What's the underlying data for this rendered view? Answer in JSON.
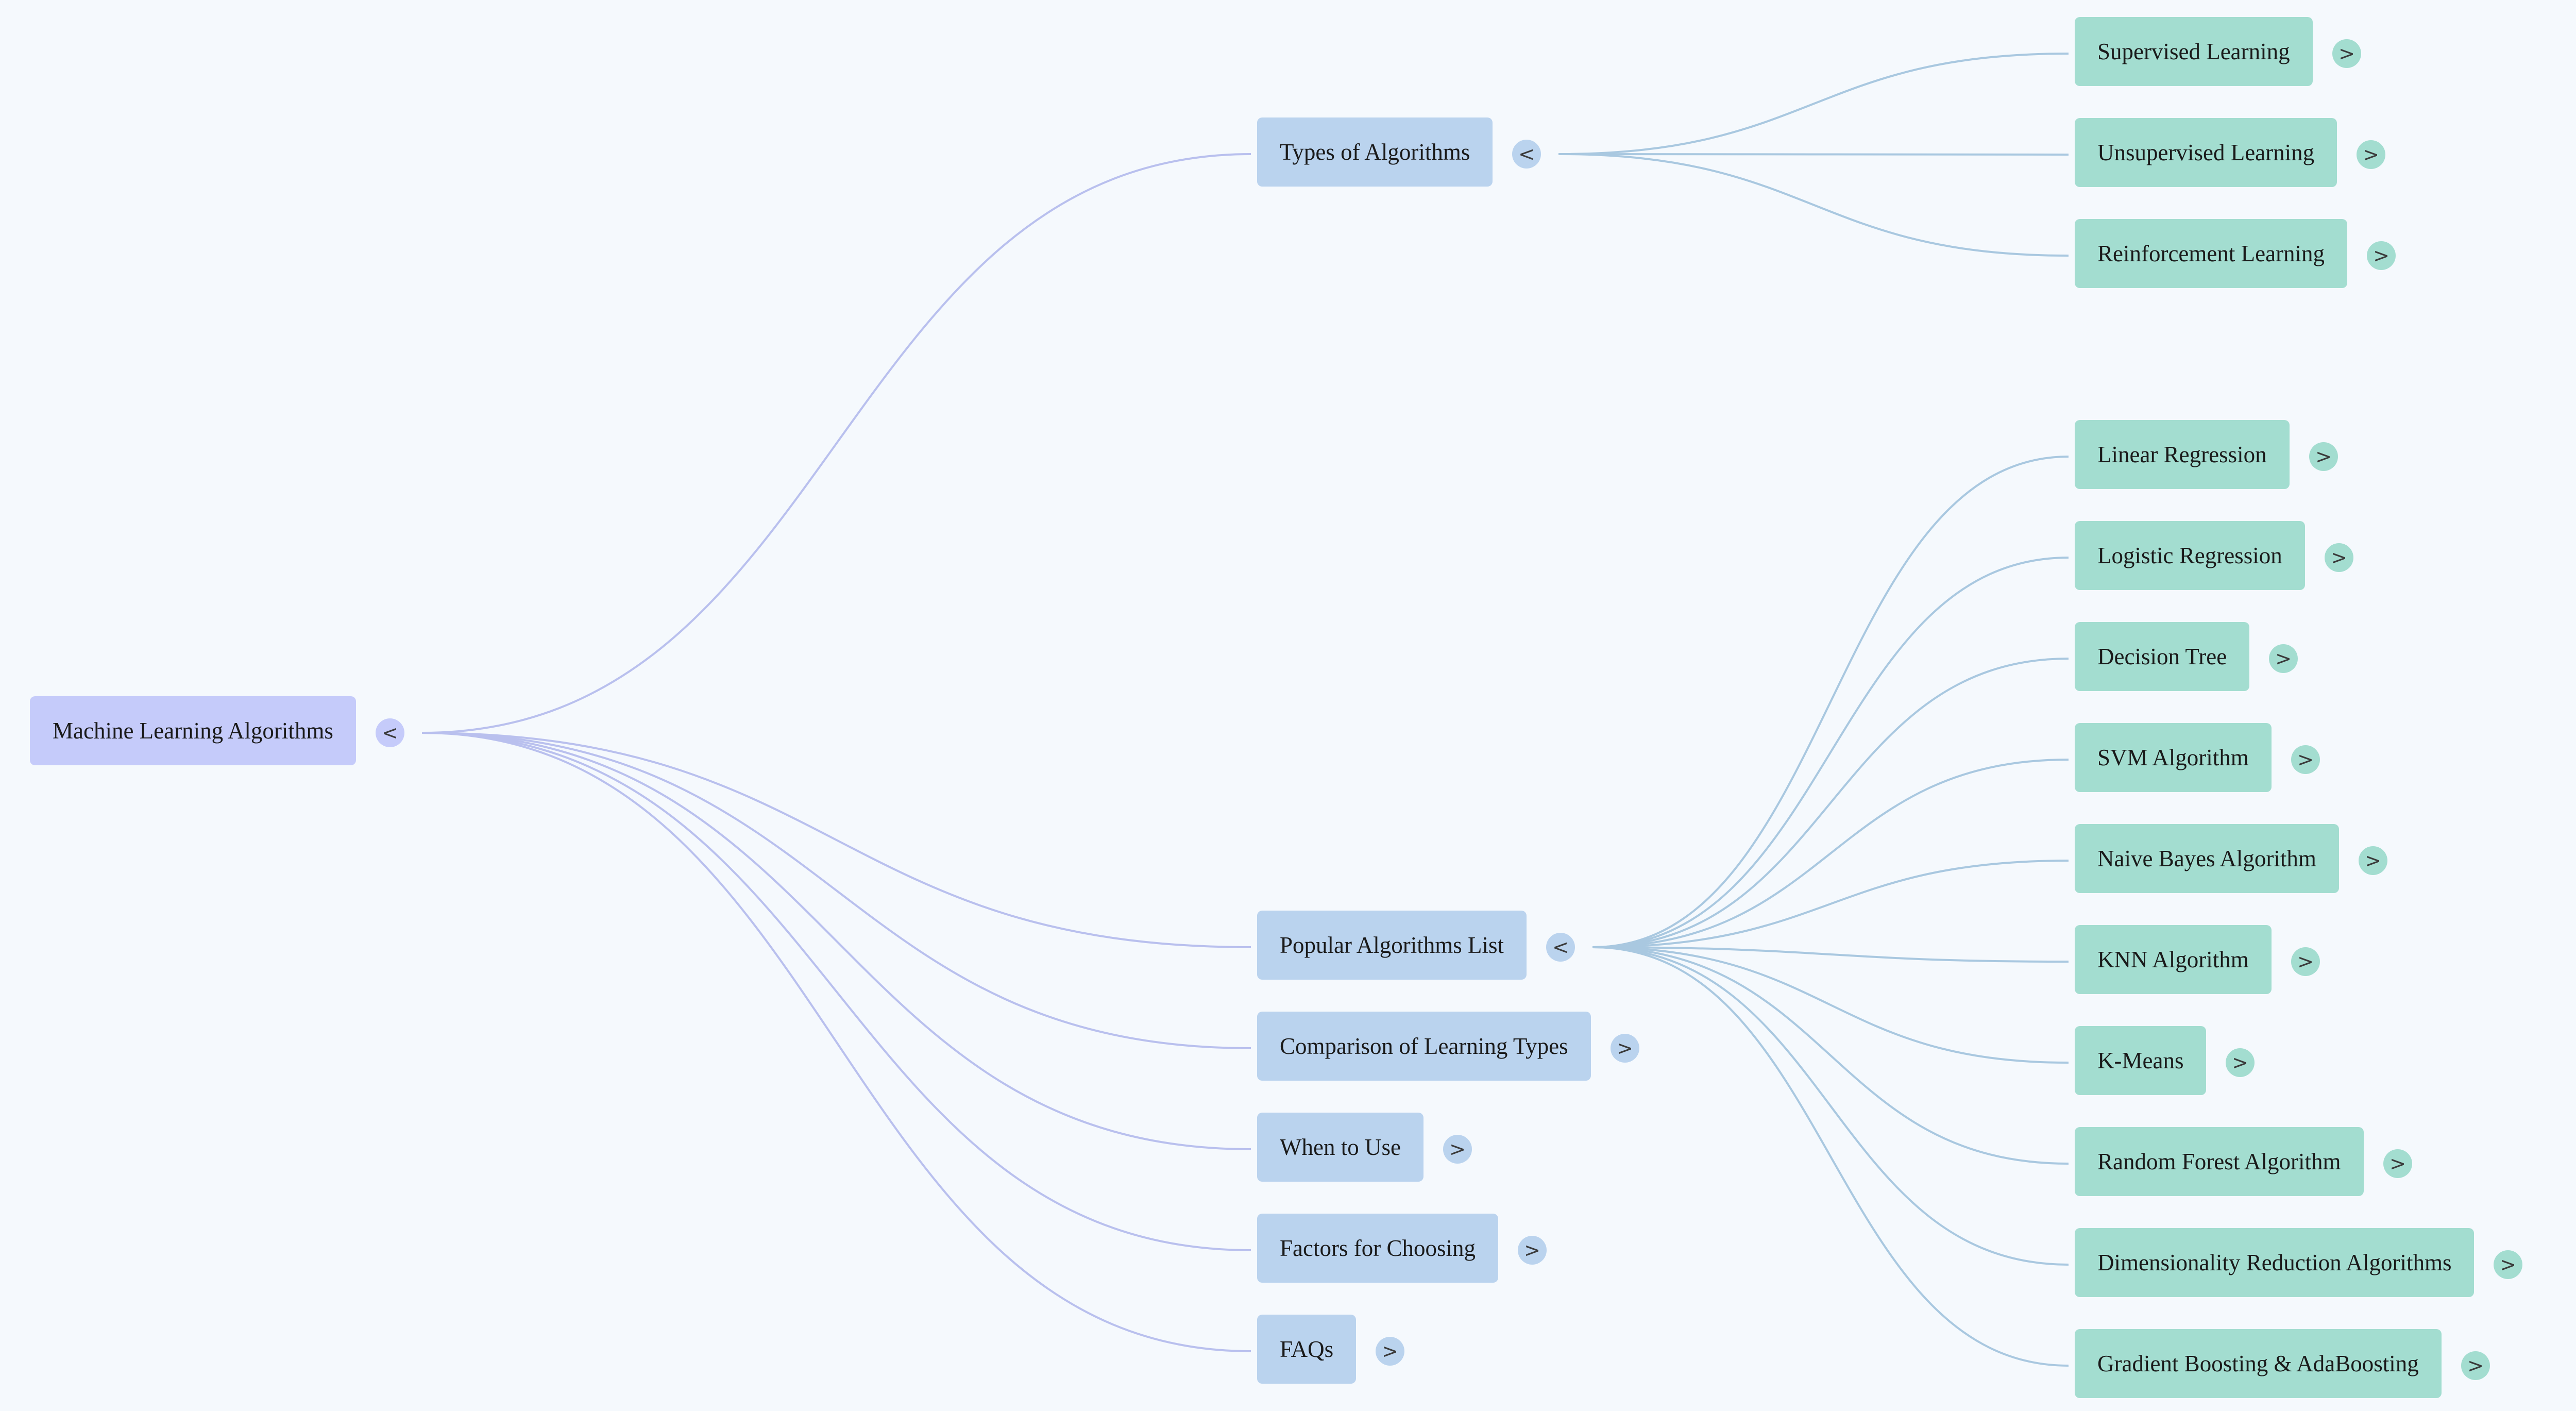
{
  "colors": {
    "background": "#f5f9fd",
    "root_fill": "#c5cbfa",
    "level1_fill": "#bad3ee",
    "level2_fill": "#a3ddd0",
    "root_edge": "#b9c0ee",
    "level1_edge": "#a9c8e0"
  },
  "root": {
    "label": "Machine Learning Algorithms",
    "toggle": "<",
    "children": [
      {
        "label": "Types of Algorithms",
        "toggle": "<",
        "children": [
          {
            "label": "Supervised Learning",
            "toggle": ">"
          },
          {
            "label": "Unsupervised Learning",
            "toggle": ">"
          },
          {
            "label": "Reinforcement Learning",
            "toggle": ">"
          }
        ]
      },
      {
        "label": "Popular Algorithms List",
        "toggle": "<",
        "children": [
          {
            "label": "Linear Regression",
            "toggle": ">"
          },
          {
            "label": "Logistic Regression",
            "toggle": ">"
          },
          {
            "label": "Decision Tree",
            "toggle": ">"
          },
          {
            "label": "SVM Algorithm",
            "toggle": ">"
          },
          {
            "label": "Naive Bayes Algorithm",
            "toggle": ">"
          },
          {
            "label": "KNN Algorithm",
            "toggle": ">"
          },
          {
            "label": "K-Means",
            "toggle": ">"
          },
          {
            "label": "Random Forest Algorithm",
            "toggle": ">"
          },
          {
            "label": "Dimensionality Reduction Algorithms",
            "toggle": ">"
          },
          {
            "label": "Gradient Boosting & AdaBoosting",
            "toggle": ">"
          }
        ]
      },
      {
        "label": "Comparison of Learning Types",
        "toggle": ">",
        "children": []
      },
      {
        "label": "When to Use",
        "toggle": ">",
        "children": []
      },
      {
        "label": "Factors for Choosing",
        "toggle": ">",
        "children": []
      },
      {
        "label": "FAQs",
        "toggle": ">",
        "children": []
      }
    ]
  }
}
